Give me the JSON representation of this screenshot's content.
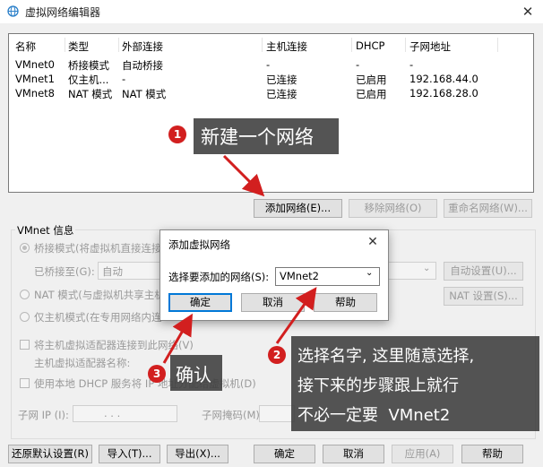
{
  "window": {
    "title": "虚拟网络编辑器",
    "close_label": "✕"
  },
  "table": {
    "headers": [
      "名称",
      "类型",
      "外部连接",
      "主机连接",
      "DHCP",
      "子网地址"
    ],
    "rows": [
      [
        "VMnet0",
        "桥接模式",
        "自动桥接",
        "-",
        "-",
        "-"
      ],
      [
        "VMnet1",
        "仅主机...",
        "-",
        "已连接",
        "已启用",
        "192.168.44.0"
      ],
      [
        "VMnet8",
        "NAT 模式",
        "NAT 模式",
        "已连接",
        "已启用",
        "192.168.28.0"
      ]
    ]
  },
  "list_buttons": {
    "add": "添加网络(E)...",
    "remove": "移除网络(O)",
    "rename": "重命名网络(W)..."
  },
  "vmnet_info": {
    "group_title": "VMnet 信息",
    "bridge_mode": "桥接模式(将虚拟机直接连接",
    "bridged_to_label": "已桥接至(G):",
    "bridged_to_value": "自动",
    "auto_settings": "自动设置(U)...",
    "nat_mode": "NAT 模式(与虚拟机共享主机",
    "nat_settings": "NAT 设置(S)...",
    "host_only": "仅主机模式(在专用网络内连",
    "connect_adapter": "将主机虚拟适配器连接到此网络(V)",
    "adapter_name_label": "主机虚拟适配器名称:",
    "use_dhcp": "使用本地 DHCP 服务将 IP 地址分配给虚拟机(D)",
    "subnet_ip_label": "子网 IP (I):",
    "subnet_mask_label": "子网掩码(M):",
    "ip_dots": ".       .       ."
  },
  "bottom_buttons": {
    "restore": "还原默认设置(R)",
    "import": "导入(T)...",
    "export": "导出(X)...",
    "ok": "确定",
    "cancel": "取消",
    "apply": "应用(A)",
    "help": "帮助"
  },
  "dialog": {
    "title": "添加虚拟网络",
    "close_label": "✕",
    "select_label": "选择要添加的网络(S):",
    "select_value": "VMnet2",
    "ok": "确定",
    "cancel": "取消",
    "help": "帮助"
  },
  "annotations": {
    "step1": {
      "num": "1",
      "text": "新建一个网络"
    },
    "step2": {
      "num": "2",
      "lines": [
        "选择名字, 这里随意选择,",
        "接下来的步骤跟上就行",
        "不必一定要  VMnet2"
      ]
    },
    "step3": {
      "num": "3",
      "text": "确认"
    }
  },
  "colors": {
    "annotation_red": "#d21f1f",
    "callout_bg": "#3c3c3c",
    "focus_blue": "#0078d7"
  }
}
